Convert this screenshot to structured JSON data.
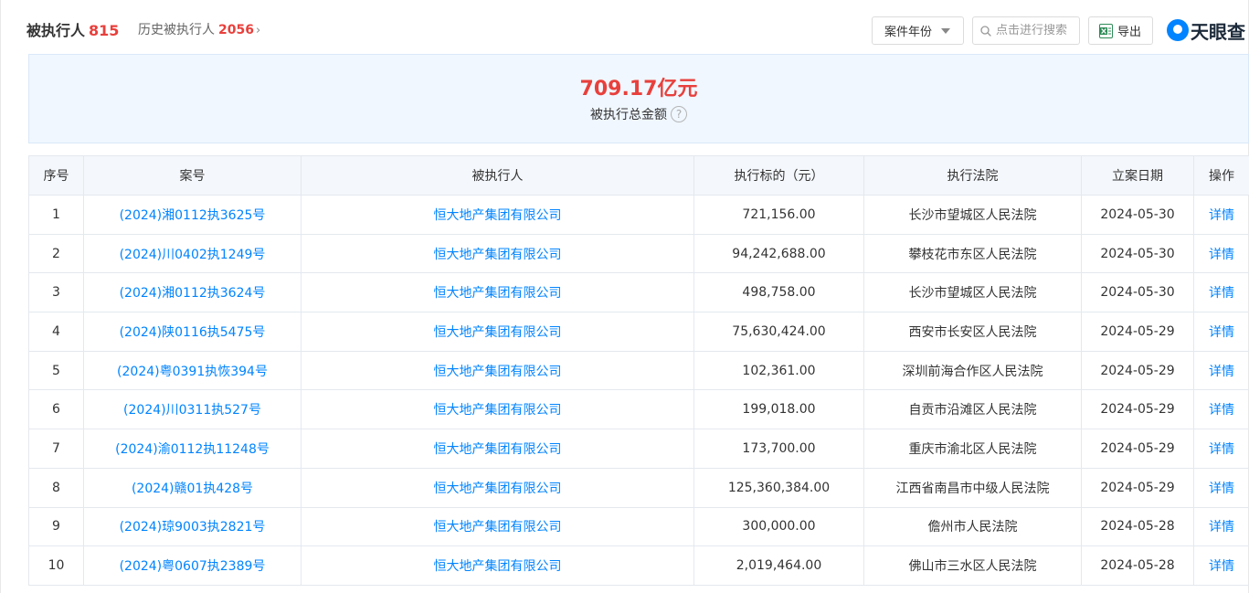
{
  "header": {
    "title": "被执行人",
    "count": "815",
    "history_label": "历史被执行人",
    "history_count": "2056",
    "history_chevron": "›",
    "year_filter": "案件年份",
    "search_placeholder": "点击进行搜索",
    "export_label": "导出",
    "logo_text": "天眼查"
  },
  "summary": {
    "amount": "709.17亿元",
    "label": "被执行总金额",
    "help": "?"
  },
  "table": {
    "columns": [
      "序号",
      "案号",
      "被执行人",
      "执行标的（元）",
      "执行法院",
      "立案日期",
      "操作"
    ],
    "rows": [
      {
        "index": "1",
        "case_no": "(2024)湘0112执3625号",
        "party": "恒大地产集团有限公司",
        "amount": "721,156.00",
        "court": "长沙市望城区人民法院",
        "date": "2024-05-30",
        "action": "详情"
      },
      {
        "index": "2",
        "case_no": "(2024)川0402执1249号",
        "party": "恒大地产集团有限公司",
        "amount": "94,242,688.00",
        "court": "攀枝花市东区人民法院",
        "date": "2024-05-30",
        "action": "详情"
      },
      {
        "index": "3",
        "case_no": "(2024)湘0112执3624号",
        "party": "恒大地产集团有限公司",
        "amount": "498,758.00",
        "court": "长沙市望城区人民法院",
        "date": "2024-05-30",
        "action": "详情"
      },
      {
        "index": "4",
        "case_no": "(2024)陕0116执5475号",
        "party": "恒大地产集团有限公司",
        "amount": "75,630,424.00",
        "court": "西安市长安区人民法院",
        "date": "2024-05-29",
        "action": "详情"
      },
      {
        "index": "5",
        "case_no": "(2024)粤0391执恢394号",
        "party": "恒大地产集团有限公司",
        "amount": "102,361.00",
        "court": "深圳前海合作区人民法院",
        "date": "2024-05-29",
        "action": "详情"
      },
      {
        "index": "6",
        "case_no": "(2024)川0311执527号",
        "party": "恒大地产集团有限公司",
        "amount": "199,018.00",
        "court": "自贡市沿滩区人民法院",
        "date": "2024-05-29",
        "action": "详情"
      },
      {
        "index": "7",
        "case_no": "(2024)渝0112执11248号",
        "party": "恒大地产集团有限公司",
        "amount": "173,700.00",
        "court": "重庆市渝北区人民法院",
        "date": "2024-05-29",
        "action": "详情"
      },
      {
        "index": "8",
        "case_no": "(2024)赣01执428号",
        "party": "恒大地产集团有限公司",
        "amount": "125,360,384.00",
        "court": "江西省南昌市中级人民法院",
        "date": "2024-05-29",
        "action": "详情"
      },
      {
        "index": "9",
        "case_no": "(2024)琼9003执2821号",
        "party": "恒大地产集团有限公司",
        "amount": "300,000.00",
        "court": "儋州市人民法院",
        "date": "2024-05-28",
        "action": "详情"
      },
      {
        "index": "10",
        "case_no": "(2024)粤0607执2389号",
        "party": "恒大地产集团有限公司",
        "amount": "2,019,464.00",
        "court": "佛山市三水区人民法院",
        "date": "2024-05-28",
        "action": "详情"
      }
    ]
  },
  "colors": {
    "accent_red": "#e8403c",
    "link_blue": "#0084ff",
    "summary_bg": "#f0f7ff",
    "header_bg": "#f4f7fb"
  },
  "icons": {
    "search": "search-icon",
    "export": "excel-icon",
    "year_caret": "caret-down-icon",
    "help": "question-circle-icon",
    "logo": "tianyancha-logo-icon"
  }
}
